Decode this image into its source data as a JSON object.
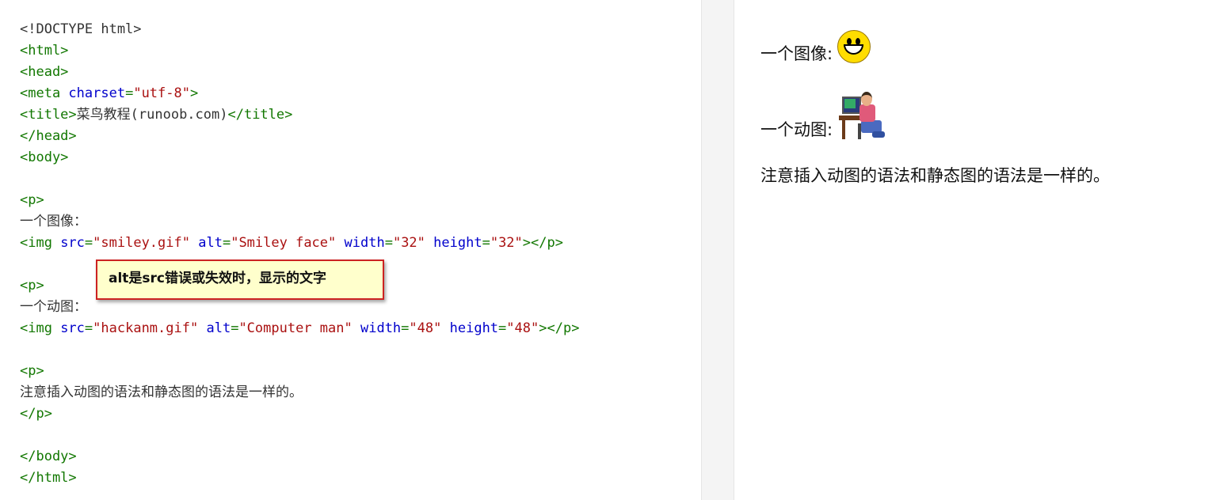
{
  "editor": {
    "lines": [
      {
        "parts": [
          [
            "txt",
            "<!DOCTYPE html>"
          ]
        ]
      },
      {
        "parts": [
          [
            "tag",
            "<html>"
          ]
        ]
      },
      {
        "parts": [
          [
            "tag",
            "<head>"
          ]
        ]
      },
      {
        "parts": [
          [
            "tag",
            "<meta "
          ],
          [
            "attr",
            "charset"
          ],
          [
            "tag",
            "="
          ],
          [
            "val",
            "\"utf-8\""
          ],
          [
            "tag",
            ">"
          ]
        ]
      },
      {
        "parts": [
          [
            "tag",
            "<title>"
          ],
          [
            "cjk",
            "菜鸟教程"
          ],
          [
            "txt",
            "(runoob.com)"
          ],
          [
            "tag",
            "</title>"
          ]
        ]
      },
      {
        "parts": [
          [
            "tag",
            "</head>"
          ]
        ]
      },
      {
        "parts": [
          [
            "tag",
            "<body>"
          ]
        ]
      },
      {
        "parts": []
      },
      {
        "parts": [
          [
            "tag",
            "<p>"
          ]
        ]
      },
      {
        "parts": [
          [
            "cjk",
            "一个图像："
          ]
        ]
      },
      {
        "parts": [
          [
            "tag",
            "<img "
          ],
          [
            "attr",
            "src"
          ],
          [
            "tag",
            "="
          ],
          [
            "val",
            "\"smiley.gif\""
          ],
          [
            "txt",
            " "
          ],
          [
            "attr",
            "alt"
          ],
          [
            "tag",
            "="
          ],
          [
            "val",
            "\"Smiley face\""
          ],
          [
            "txt",
            " "
          ],
          [
            "attr",
            "width"
          ],
          [
            "tag",
            "="
          ],
          [
            "val",
            "\"32\""
          ],
          [
            "txt",
            " "
          ],
          [
            "attr",
            "height"
          ],
          [
            "tag",
            "="
          ],
          [
            "val",
            "\"32\""
          ],
          [
            "tag",
            "></p>"
          ]
        ]
      },
      {
        "parts": []
      },
      {
        "parts": [
          [
            "tag",
            "<p>"
          ]
        ]
      },
      {
        "parts": [
          [
            "cjk",
            "一个动图："
          ]
        ]
      },
      {
        "parts": [
          [
            "tag",
            "<img "
          ],
          [
            "attr",
            "src"
          ],
          [
            "tag",
            "="
          ],
          [
            "val",
            "\"hackanm.gif\""
          ],
          [
            "txt",
            " "
          ],
          [
            "attr",
            "alt"
          ],
          [
            "tag",
            "="
          ],
          [
            "val",
            "\"Computer man\""
          ],
          [
            "txt",
            " "
          ],
          [
            "attr",
            "width"
          ],
          [
            "tag",
            "="
          ],
          [
            "val",
            "\"48\""
          ],
          [
            "txt",
            " "
          ],
          [
            "attr",
            "height"
          ],
          [
            "tag",
            "="
          ],
          [
            "val",
            "\"48\""
          ],
          [
            "tag",
            "></p>"
          ]
        ]
      },
      {
        "parts": []
      },
      {
        "parts": [
          [
            "tag",
            "<p>"
          ]
        ]
      },
      {
        "parts": [
          [
            "cjk",
            "注意插入动图的语法和静态图的语法是一样的。"
          ]
        ]
      },
      {
        "parts": [
          [
            "tag",
            "</p>"
          ]
        ]
      },
      {
        "parts": []
      },
      {
        "parts": [
          [
            "tag",
            "</body>"
          ]
        ]
      },
      {
        "parts": [
          [
            "tag",
            "</html>"
          ]
        ]
      }
    ]
  },
  "tooltip": {
    "text": "alt是src错误或失效时，显示的文字"
  },
  "preview": {
    "image_label": "一个图像:",
    "animation_label": "一个动图:",
    "note": "注意插入动图的语法和静态图的语法是一样的。",
    "image_icon": "smiley-face",
    "animation_icon": "computer-man"
  },
  "colors": {
    "tag": "#117700",
    "attr": "#0000cc",
    "value": "#aa1111",
    "text": "#333333",
    "tooltip_bg": "#ffffcc",
    "tooltip_border": "#cc2222"
  }
}
